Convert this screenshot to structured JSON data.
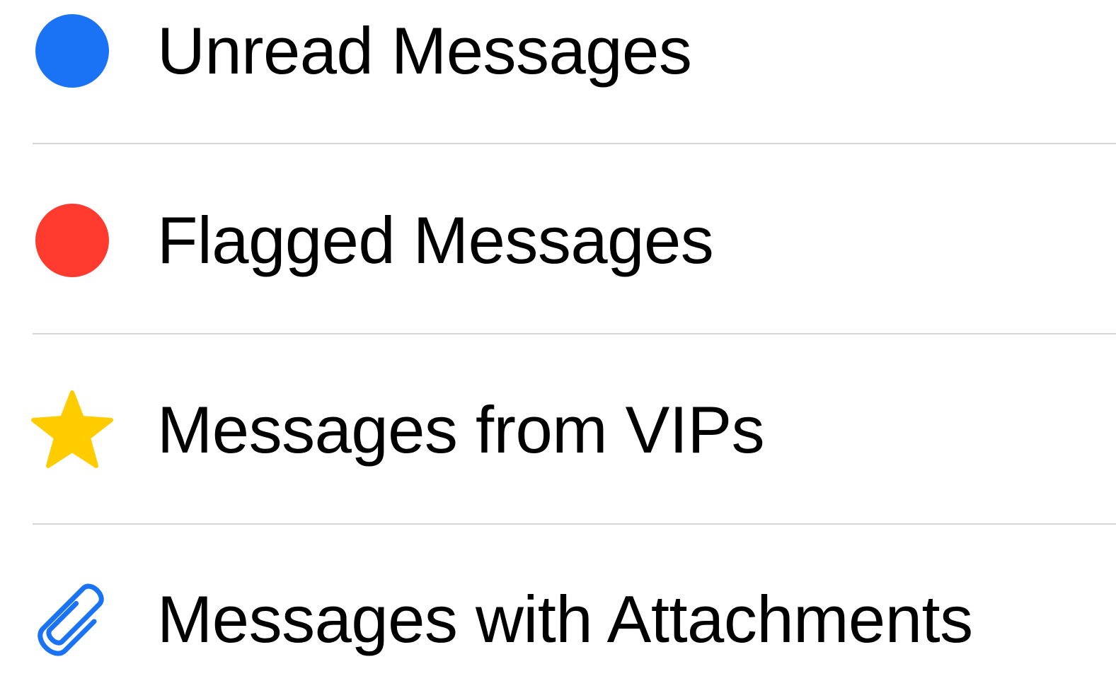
{
  "filters": [
    {
      "label": "Unread Messages",
      "icon": "blue-dot-icon",
      "color": "#1a73f5"
    },
    {
      "label": "Flagged Messages",
      "icon": "red-dot-icon",
      "color": "#ff3b30"
    },
    {
      "label": "Messages from VIPs",
      "icon": "star-icon",
      "color": "#ffcc00"
    },
    {
      "label": "Messages with Attachments",
      "icon": "paperclip-icon",
      "color": "#1a73f5"
    }
  ]
}
